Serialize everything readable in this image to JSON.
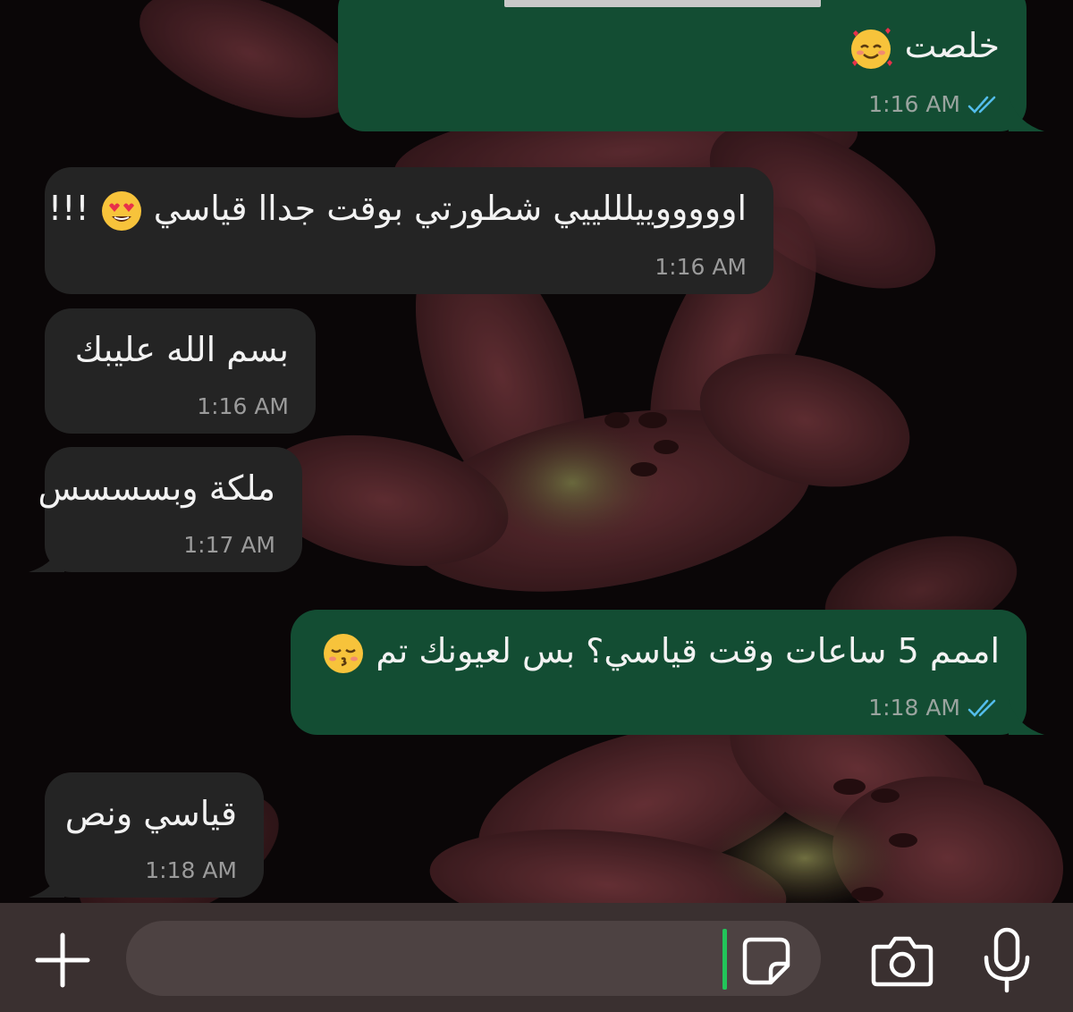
{
  "messages": [
    {
      "text": "خلصت",
      "emoji": "smiling-face-with-hearts",
      "time": "1:16 AM",
      "direction": "outgoing",
      "status": "read"
    },
    {
      "text": "اوووووييلللييي شطورتي بوقت جداا قياسي",
      "text_suffix": "!!!",
      "emoji": "heart-eyes-face",
      "time": "1:16 AM",
      "direction": "incoming"
    },
    {
      "text": "بسم الله عليبك",
      "time": "1:16 AM",
      "direction": "incoming"
    },
    {
      "text": "ملكة وبسسسس",
      "time": "1:17 AM",
      "direction": "incoming"
    },
    {
      "text": "اممم 5 ساعات وقت قياسي؟ بس لعيونك تم",
      "emoji": "kissing-face-closed-eyes",
      "time": "1:18 AM",
      "direction": "outgoing",
      "status": "read"
    },
    {
      "text": "قياسي ونص",
      "time": "1:18 AM",
      "direction": "incoming"
    }
  ],
  "composer": {
    "placeholder": "",
    "icons": [
      "plus-icon",
      "sticker-icon",
      "camera-icon",
      "microphone-icon"
    ]
  },
  "colors": {
    "outgoing_bubble": "#134d33",
    "incoming_bubble": "#242424",
    "read_ticks": "#53bdeb",
    "cursor": "#22c45a",
    "composer_bar": "#3a3030"
  }
}
